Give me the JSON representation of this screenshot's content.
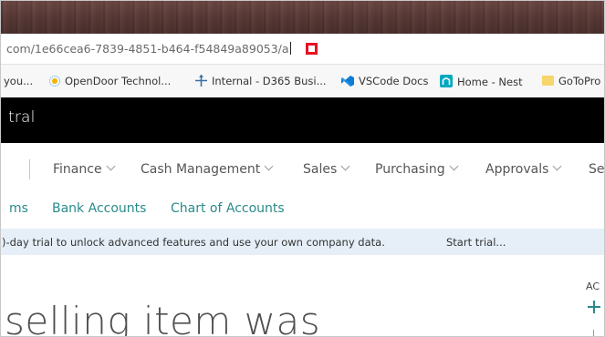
{
  "browser": {
    "address_bar": {
      "url": "com/1e66cea6-7839-4851-b464-f54849a89053/a"
    },
    "favorites": [
      {
        "label": "you...",
        "icon": "none"
      },
      {
        "label": "OpenDoor Technol...",
        "icon": "opendoor-icon"
      },
      {
        "label": "Internal - D365 Busi...",
        "icon": "dynamics-icon"
      },
      {
        "label": "VSCode Docs",
        "icon": "vscode-icon"
      },
      {
        "label": "Home - Nest",
        "icon": "nest-icon"
      },
      {
        "label": "GoToPro",
        "icon": "folder-icon"
      }
    ]
  },
  "app": {
    "title": "tral",
    "nav": [
      {
        "label": "Finance"
      },
      {
        "label": "Cash Management"
      },
      {
        "label": "Sales"
      },
      {
        "label": "Purchasing"
      },
      {
        "label": "Approvals"
      },
      {
        "label": "Se"
      }
    ],
    "links": [
      {
        "label": "ms"
      },
      {
        "label": "Bank Accounts"
      },
      {
        "label": "Chart of Accounts"
      }
    ],
    "banner": {
      "text": ")-day trial to unlock advanced features and use your own company data.",
      "action": "Start trial..."
    },
    "content": {
      "headline": "selling item was",
      "side_label": "AC"
    }
  },
  "colors": {
    "accent": "#2a8a8a",
    "stop_red": "#e81123",
    "banner_bg": "#e6eff8",
    "header_bg": "#000000"
  }
}
